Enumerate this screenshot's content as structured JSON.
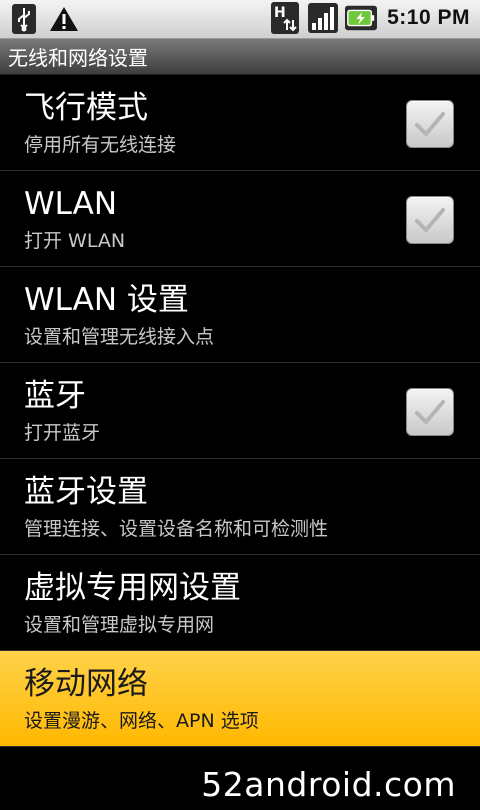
{
  "status_bar": {
    "time": "5:10 PM",
    "icons": [
      "usb-icon",
      "warning-icon",
      "hspa-data-icon",
      "signal-icon",
      "battery-charging-icon"
    ]
  },
  "title_bar": {
    "title": "无线和网络设置"
  },
  "settings": [
    {
      "title": "飞行模式",
      "subtitle": "停用所有无线连接",
      "has_checkbox": true,
      "checked": true
    },
    {
      "title": "WLAN",
      "subtitle": "打开 WLAN",
      "has_checkbox": true,
      "checked": true
    },
    {
      "title": "WLAN 设置",
      "subtitle": "设置和管理无线接入点",
      "has_checkbox": false
    },
    {
      "title": "蓝牙",
      "subtitle": "打开蓝牙",
      "has_checkbox": true,
      "checked": true
    },
    {
      "title": "蓝牙设置",
      "subtitle": "管理连接、设置设备名称和可检测性",
      "has_checkbox": false
    },
    {
      "title": "虚拟专用网设置",
      "subtitle": "设置和管理虚拟专用网",
      "has_checkbox": false
    },
    {
      "title": "移动网络",
      "subtitle": "设置漫游、网络、APN 选项",
      "has_checkbox": false,
      "selected": true
    }
  ],
  "watermark": "52android.com",
  "colors": {
    "selected_highlight": "#ffc20e",
    "background": "#000000",
    "subtitle_text": "#c8c8c8"
  }
}
